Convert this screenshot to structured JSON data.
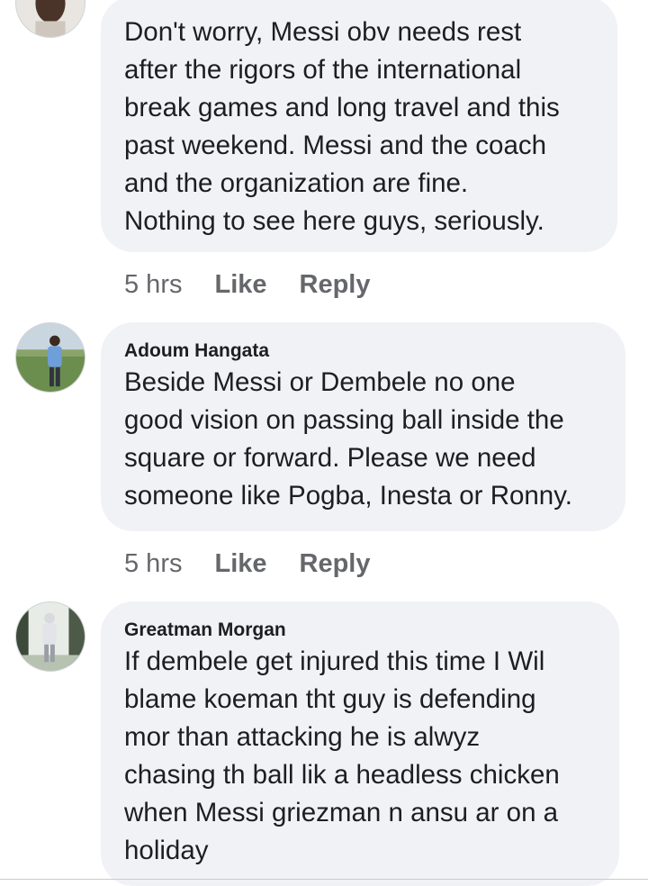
{
  "comments": [
    {
      "author": "",
      "text": "Don't worry, Messi obv needs rest\nafter the rigors of the international\nbreak games and long travel and this\npast weekend.  Messi and the coach\nand the  organization are fine.\nNothing to see here guys, seriously.",
      "time": "5 hrs",
      "like_label": "Like",
      "reply_label": "Reply"
    },
    {
      "author": "Adoum Hangata",
      "text": "Beside Messi or Dembele no one\ngood vision on passing ball inside the\nsquare or forward. Please we need\nsomeone like Pogba, Inesta or Ronny.",
      "time": "5 hrs",
      "like_label": "Like",
      "reply_label": "Reply"
    },
    {
      "author": "Greatman Morgan",
      "text": "If dembele get injured this time I Wil\nblame koeman tht guy is defending\nmor than attacking he is alwyz\nchasing th ball lik a headless chicken\nwhen Messi griezman n ansu ar on a\nholiday",
      "time": "",
      "like_label": "",
      "reply_label": ""
    }
  ],
  "colors": {
    "bubble_bg": "#f0f2f5",
    "text": "#1c1e21",
    "meta": "#65676b"
  }
}
